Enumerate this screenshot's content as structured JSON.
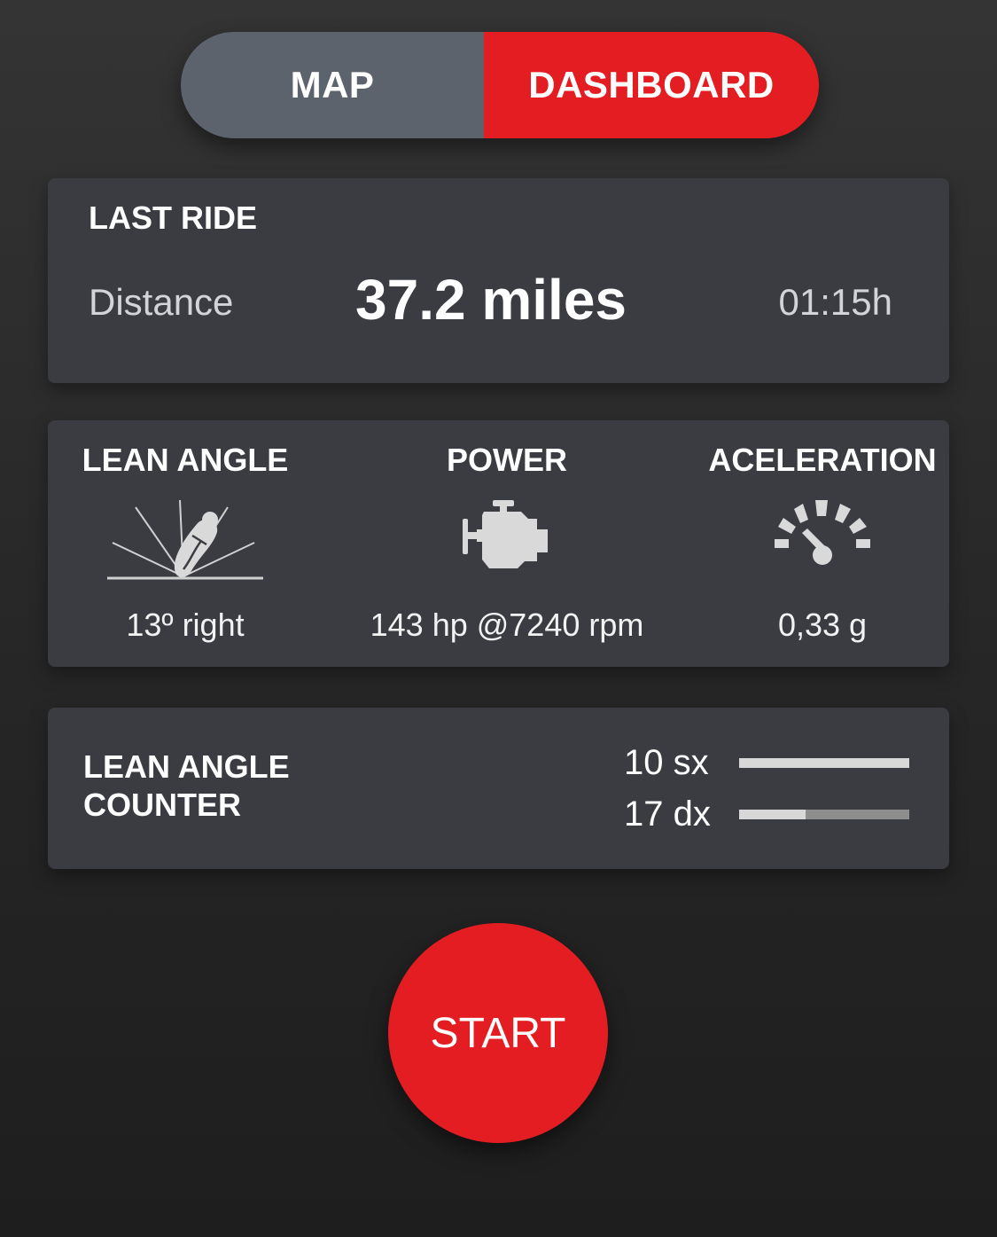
{
  "toggle": {
    "map_label": "MAP",
    "dashboard_label": "DASHBOARD",
    "active": "dashboard"
  },
  "last_ride": {
    "title": "LAST RIDE",
    "label": "Distance",
    "value": "37.2 miles",
    "duration": "01:15h"
  },
  "metrics": [
    {
      "title": "LEAN ANGLE",
      "icon": "motorbike-lean-icon",
      "value": "13º right"
    },
    {
      "title": "POWER",
      "icon": "engine-icon",
      "value": "143 hp @7240 rpm"
    },
    {
      "title": "ACELERATION",
      "icon": "speedometer-icon",
      "value": "0,33 g"
    }
  ],
  "lean_counter": {
    "title_line1": "LEAN ANGLE",
    "title_line2": "COUNTER",
    "rows": [
      {
        "label": "10 sx",
        "fraction": 1.0
      },
      {
        "label": "17 dx",
        "fraction": 0.39
      }
    ]
  },
  "start_button": {
    "label": "START"
  },
  "colors": {
    "accent": "#e41d22",
    "card": "#3a3c41",
    "toggle_inactive": "#5d636d"
  }
}
